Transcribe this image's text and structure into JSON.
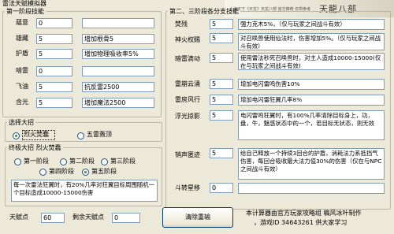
{
  "window": {
    "title": "雷法天赋模拟器"
  },
  "header": {
    "subtitle": "上海天下《天龙》天龙八部 官方推荐 仅供参考",
    "logo": "天龍八部"
  },
  "stage1": {
    "legend": "第一阶段技能",
    "rows": [
      {
        "label": "蘊意",
        "value": "0",
        "desc": ""
      },
      {
        "label": "雄藏",
        "value": "5",
        "desc": "增加根骨5"
      },
      {
        "label": "护盾",
        "value": "5",
        "desc": "增加物理吸收率5%"
      },
      {
        "label": "喑雷",
        "value": "0",
        "desc": ""
      },
      {
        "label": "飞油",
        "value": "5",
        "desc": "抗反雷2500"
      },
      {
        "label": "含光",
        "value": "5",
        "desc": "增加魔法2500"
      }
    ]
  },
  "choose": {
    "legend": "选择大招",
    "options": [
      {
        "label": "烈火焚蠢",
        "selected": true
      },
      {
        "label": "五雷轰顶",
        "selected": false
      }
    ]
  },
  "final": {
    "legend": "终极大招 烈火焚蠢",
    "stages": [
      {
        "label": "第一阶段",
        "selected": false
      },
      {
        "label": "第二阶段",
        "selected": false
      },
      {
        "label": "第三阶段",
        "selected": false
      },
      {
        "label": "第四阶段",
        "selected": false
      },
      {
        "label": "第五阶段",
        "selected": true
      }
    ],
    "desc": "每一次雷法狂翼时，有20%几率对狂翼目标周围随机一个目标造成10000-15000伤害"
  },
  "points": {
    "talent_label": "天赋点",
    "talent_value": "60",
    "remain_label": "剩余天赋点",
    "remain_value": "0"
  },
  "stage23": {
    "legend": "第二、三阶段各分支技能",
    "rows": [
      {
        "label": "焚残",
        "value": "5",
        "desc": "强力克木5%，（仅与玩家之间战斗有效）"
      },
      {
        "label": "神火权赐",
        "value": "5",
        "desc": "对召唤兽使用仙法时，伤害增加5%。（仅与玩家之间战斗有效）"
      },
      {
        "label": "暗雷滴动",
        "value": "5",
        "desc": "使用雷法秒死召唤兽时，对主人造成10000-15000(仅在与玩家之间战斗有效)"
      },
      {
        "label": "雷崩云涌",
        "value": "5",
        "desc": "增加电闪雷鸣伤害10%"
      },
      {
        "label": "雷房风行",
        "value": "5",
        "desc": "增加电闪雷狂翼几率8%"
      },
      {
        "label": "浮光掠影",
        "value": "5",
        "desc": "电闪雷鸣狂翼时，有100%几率清除目标身上，功，盘，牛，魅惑状态中的一个，若目标无状态，则无效"
      },
      {
        "label": "销声匿迹",
        "value": "5",
        "desc": "给自己释放一个持续3回合的护盾，消耗法力系抵挡气伤害，每回合吸收最大法力值30%的伤害（仅在与NPC之间战斗有效）"
      },
      {
        "label": "斗转星移",
        "value": "0",
        "desc": ""
      }
    ]
  },
  "reset_label": "清除重输",
  "credits": {
    "line1": "本计算器由官方玩家攻略组 稿风冰叶制作",
    "line2": "，游戏ID 34643261 供大家学习"
  }
}
